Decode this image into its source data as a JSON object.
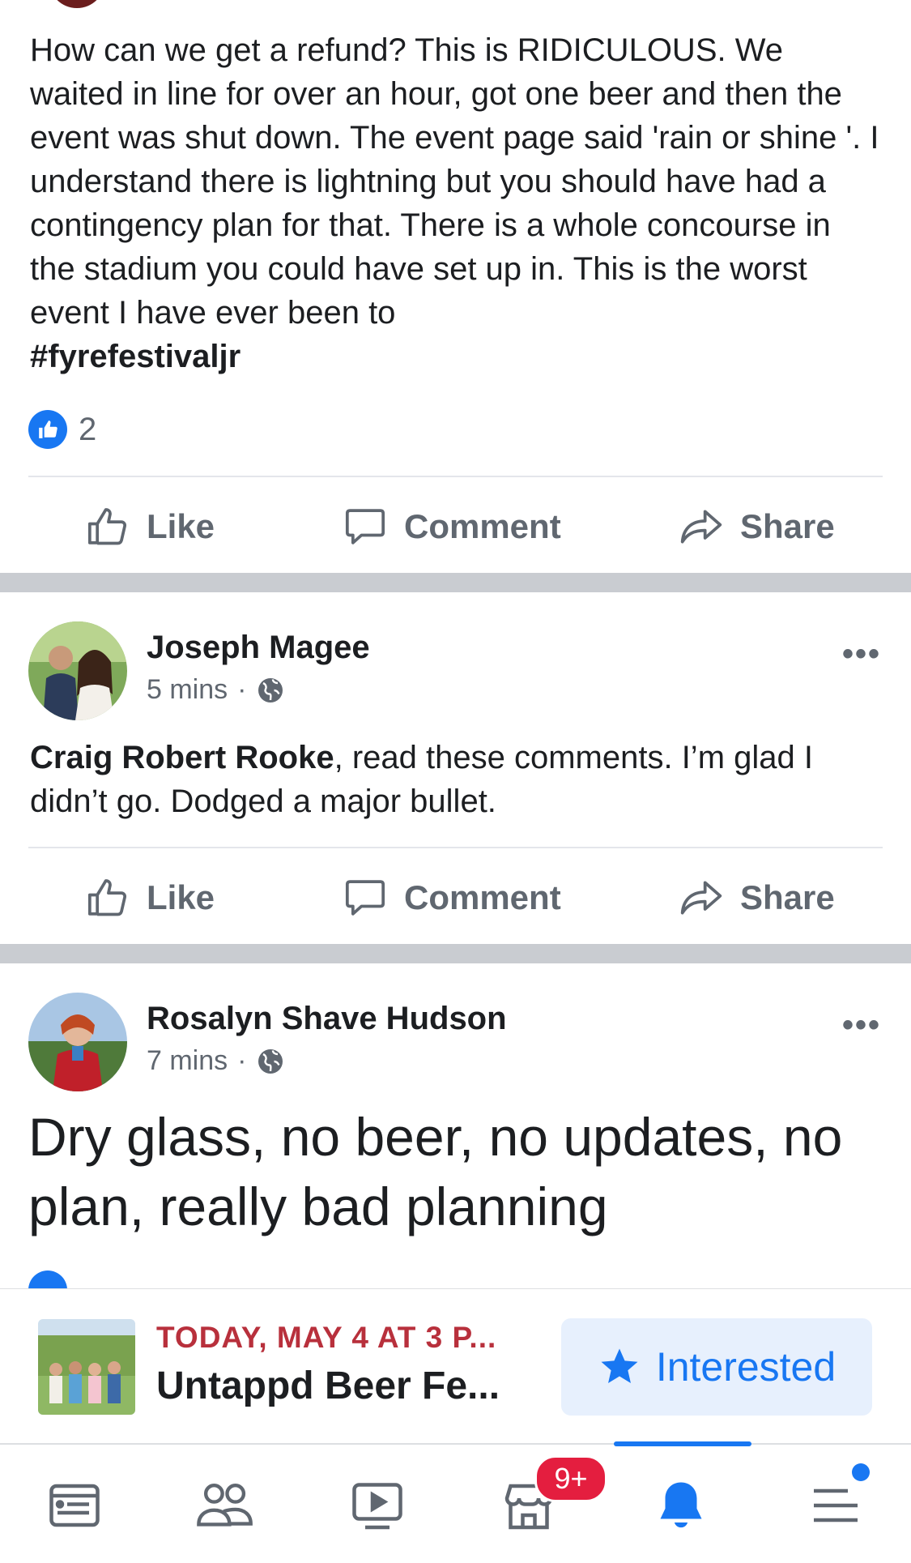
{
  "comment1": {
    "text": "How can we get a refund? This is RIDICULOUS. We waited in line for over an hour, got one beer and then the event was shut down. The event page said 'rain or shine '. I understand there is lightning but you should have had a contingency plan for that. There is a whole concourse in the stadium you could have set up in. This is the worst event I have ever been to",
    "hashtag": "#fyrefestivaljr",
    "like_count": "2"
  },
  "actions": {
    "like": "Like",
    "comment": "Comment",
    "share": "Share"
  },
  "post2": {
    "author": "Joseph Magee",
    "time": "5 mins",
    "separator": "·",
    "mention": "Craig Robert Rooke",
    "text": ", read these comments. I’m glad I didn’t go. Dodged a major bullet.",
    "more": "•••"
  },
  "post3": {
    "author": "Rosalyn Shave Hudson",
    "time": "7 mins",
    "separator": "·",
    "text": "Dry glass,  no beer,  no updates,  no plan,  really bad planning",
    "more": "•••"
  },
  "event": {
    "date": "TODAY, MAY 4 AT 3 P...",
    "title": "Untappd Beer Fe...",
    "interested_label": "Interested"
  },
  "tabbar": {
    "badge": "9+",
    "icons": [
      "news-feed-icon",
      "friends-icon",
      "watch-icon",
      "marketplace-icon",
      "notifications-icon",
      "menu-icon"
    ],
    "active_color": "#1877f2"
  }
}
